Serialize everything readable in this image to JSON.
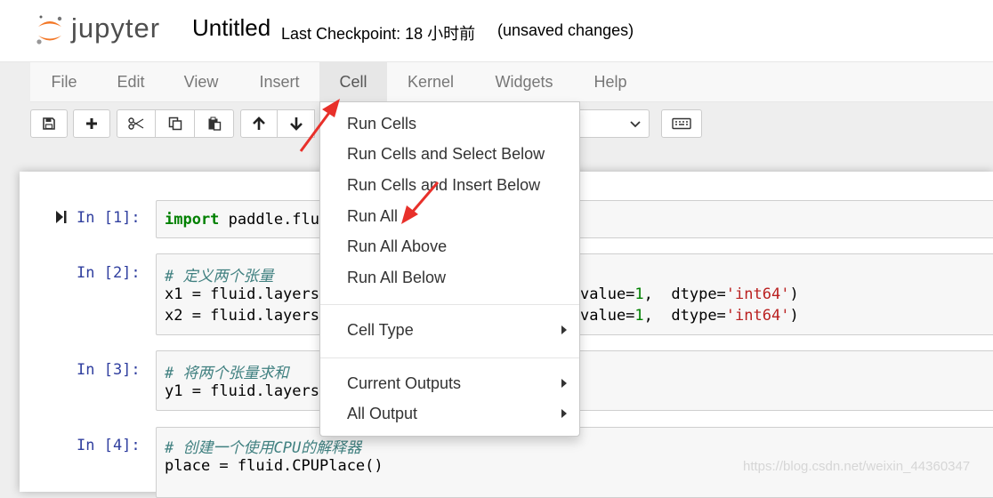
{
  "header": {
    "logo_text": "jupyter",
    "notebook_title": "Untitled",
    "checkpoint": "Last Checkpoint: 18 小时前",
    "unsaved": "(unsaved changes)"
  },
  "menubar": {
    "items": [
      {
        "label": "File"
      },
      {
        "label": "Edit"
      },
      {
        "label": "View"
      },
      {
        "label": "Insert"
      },
      {
        "label": "Cell"
      },
      {
        "label": "Kernel"
      },
      {
        "label": "Widgets"
      },
      {
        "label": "Help"
      }
    ],
    "open_menu": "Cell"
  },
  "toolbar": {
    "icons": [
      "save-icon",
      "plus-icon",
      "scissors-icon",
      "copy-icon",
      "paste-icon",
      "arrow-up-icon",
      "arrow-down-icon",
      "keyboard-icon"
    ]
  },
  "cell_menu": {
    "items": [
      "Run Cells",
      "Run Cells and Select Below",
      "Run Cells and Insert Below",
      "Run All",
      "Run All Above",
      "Run All Below"
    ],
    "cell_type": "Cell Type",
    "current_outputs": "Current Outputs",
    "all_output": "All Output"
  },
  "cells": [
    {
      "prompt": "In  [1]:",
      "line1_kw": "import",
      "line1_rest": " paddle.flu"
    },
    {
      "prompt": "In  [2]:",
      "comment": "# 定义两个张量",
      "line1": "x1 = fluid.layers.",
      "line2": "x2 = fluid.layers.",
      "tail_a": "value=",
      "tail_num": "1",
      "tail_b": ",  dtype=",
      "tail_str": "'int64'",
      "tail_c": ")"
    },
    {
      "prompt": "In  [3]:",
      "comment": "# 将两个张量求和",
      "line1": "y1 = fluid.layers."
    },
    {
      "prompt": "In  [4]:",
      "comment": "# 创建一个使用CPU的解释器",
      "line1": "place = fluid.CPUPlace()"
    }
  ],
  "watermark": "https://blog.csdn.net/weixin_44360347",
  "colors": {
    "annotation_arrow": "#e8302a",
    "prompt": "#303f9f",
    "keyword": "#008000"
  }
}
